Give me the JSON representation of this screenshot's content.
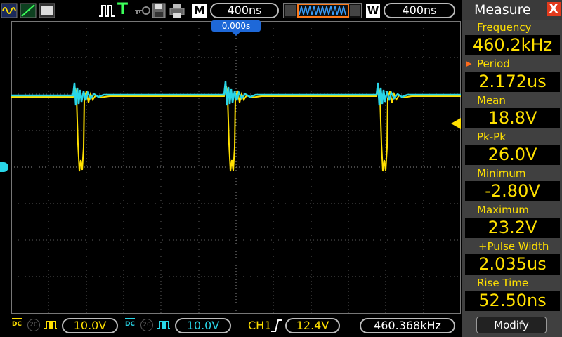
{
  "top_bar": {
    "m_label": "M",
    "timebase": "400ns",
    "w_label": "W",
    "window_timebase": "400ns",
    "trigger_status": "T"
  },
  "screen": {
    "trigger_position": "0.000s"
  },
  "bottom_bar": {
    "ch1": {
      "coupling": "DC",
      "bw_limit": "20",
      "volts_div": "10.0V"
    },
    "ch2": {
      "coupling": "DC",
      "bw_limit": "20",
      "volts_div": "10.0V"
    },
    "trigger": {
      "source": "CH1",
      "level": "12.4V"
    },
    "frequency": "460.368kHz"
  },
  "measure_panel": {
    "title": "Measure",
    "close_label": "X",
    "items": [
      {
        "label": "Frequency",
        "value": "460.2kHz"
      },
      {
        "label": "Period",
        "value": "2.172us",
        "selected": true
      },
      {
        "label": "Mean",
        "value": "18.8V"
      },
      {
        "label": "Pk-Pk",
        "value": "26.0V"
      },
      {
        "label": "Minimum",
        "value": "-2.80V"
      },
      {
        "label": "Maximum",
        "value": "23.2V"
      },
      {
        "label": "+Pulse Width",
        "value": "2.035us"
      },
      {
        "label": "Rise Time",
        "value": "52.50ns"
      }
    ],
    "modify_label": "Modify"
  },
  "colors": {
    "ch1": "#ffe000",
    "ch2": "#29d6e8",
    "trigger_marker": "#1e68d8",
    "close_button": "#e33a1c"
  }
}
